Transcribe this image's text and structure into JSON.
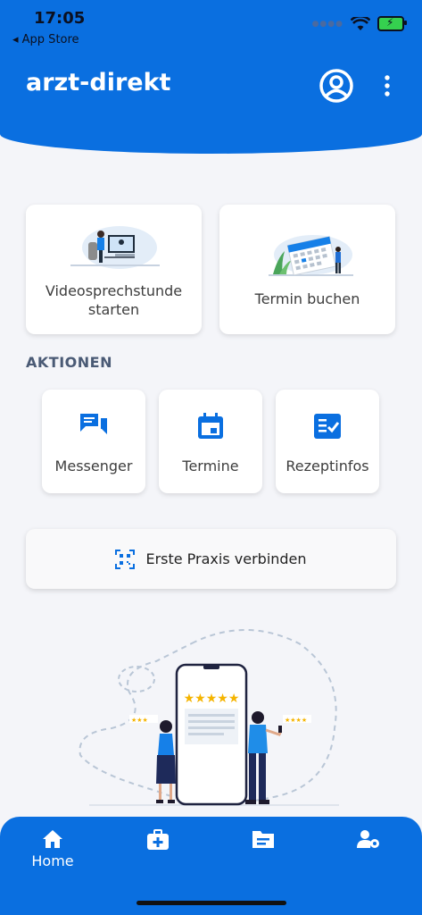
{
  "status_bar": {
    "time": "17:05",
    "back_label": "◂ App Store"
  },
  "header": {
    "title": "arzt-direkt"
  },
  "top_cards": [
    {
      "label": "Videosprechstunde\nstarten"
    },
    {
      "label": "Termin buchen"
    }
  ],
  "section": {
    "title": "AKTIONEN"
  },
  "actions": [
    {
      "label": "Messenger",
      "icon": "chat-icon"
    },
    {
      "label": "Termine",
      "icon": "calendar-icon"
    },
    {
      "label": "Rezeptinfos",
      "icon": "prescription-icon"
    }
  ],
  "connect_button": {
    "label": "Erste Praxis verbinden",
    "icon": "qr-scan-icon"
  },
  "tabbar": [
    {
      "label": "Home",
      "icon": "home-icon"
    },
    {
      "label": "",
      "icon": "medical-bag-icon"
    },
    {
      "label": "",
      "icon": "folder-icon"
    },
    {
      "label": "",
      "icon": "user-settings-icon"
    }
  ],
  "colors": {
    "primary": "#0a6fe0",
    "background": "#f4f5f9",
    "section": "#4a5a75"
  }
}
